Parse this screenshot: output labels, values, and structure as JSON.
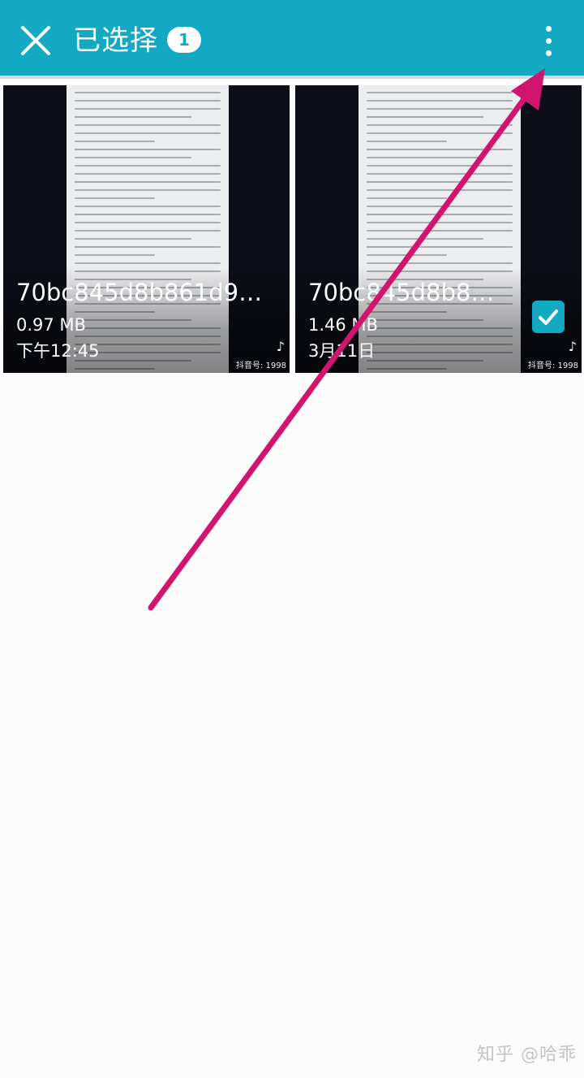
{
  "header": {
    "close_icon": "close-icon",
    "title": "已选择",
    "selected_count": "1",
    "more_icon": "more-vertical-icon"
  },
  "files": [
    {
      "name": "70bc845d8b861d98...",
      "size": "0.97 MB",
      "date": "下午12:45",
      "selected": false
    },
    {
      "name": "70bc845d8b861...",
      "size": "1.46 MB",
      "date": "3月11日",
      "selected": true
    }
  ],
  "thumbnail_watermark": {
    "logo_icon": "tiktok-icon",
    "text": "抖音号: 1998"
  },
  "annotation": {
    "type": "arrow",
    "color": "#d1156f"
  },
  "watermark": "知乎 @哈乖",
  "colors": {
    "accent": "#13a9c3",
    "background": "#fcfcfc",
    "arrow": "#d1156f"
  }
}
